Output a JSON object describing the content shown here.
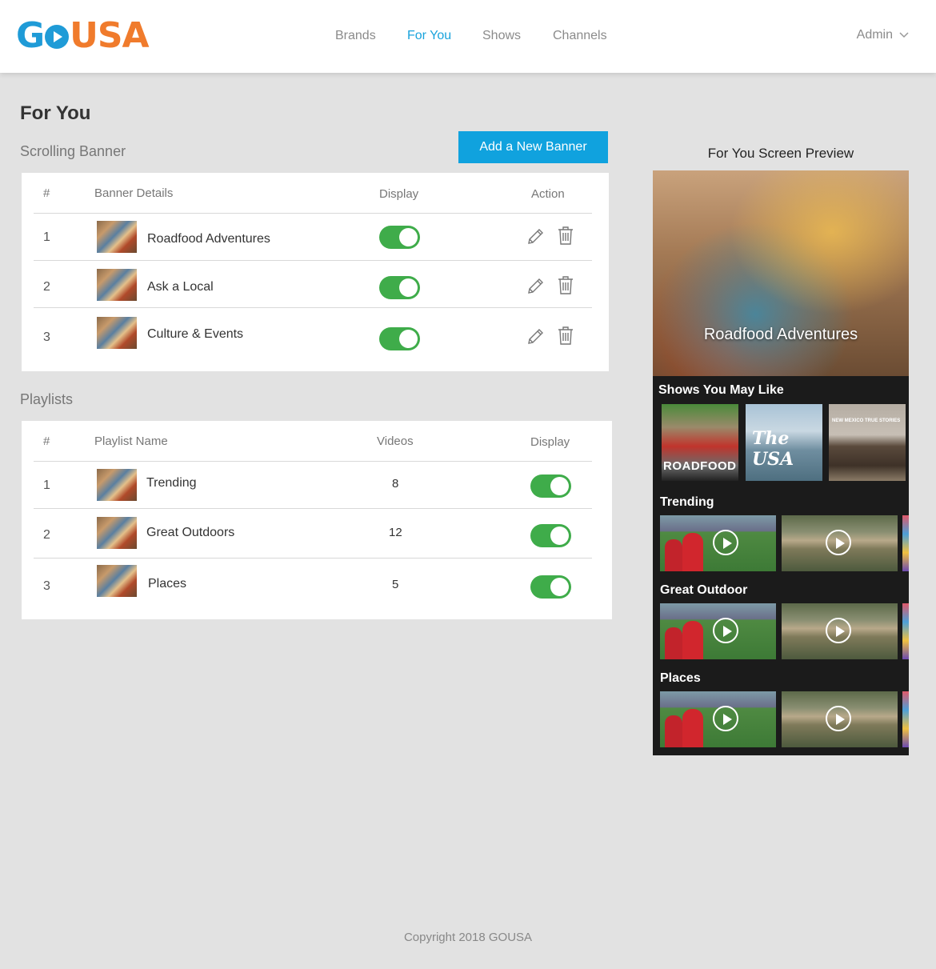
{
  "logo": {
    "part1": "Go",
    "part2": "USA"
  },
  "nav": {
    "items": [
      {
        "label": "Brands",
        "active": false
      },
      {
        "label": "For You",
        "active": true
      },
      {
        "label": "Shows",
        "active": false
      },
      {
        "label": "Channels",
        "active": false
      }
    ],
    "user_label": "Admin"
  },
  "page": {
    "title": "For You"
  },
  "banner_section": {
    "title": "Scrolling Banner",
    "add_button": "Add a New Banner",
    "headers": {
      "num": "#",
      "details": "Banner Details",
      "display": "Display",
      "action": "Action"
    },
    "rows": [
      {
        "num": "1",
        "name": "Roadfood Adventures",
        "display": true
      },
      {
        "num": "2",
        "name": "Ask a Local",
        "display": true
      },
      {
        "num": "3",
        "name": "Culture & Events",
        "display": true
      }
    ]
  },
  "playlist_section": {
    "title": "Playlists",
    "headers": {
      "num": "#",
      "name": "Playlist Name",
      "videos": "Videos",
      "display": "Display"
    },
    "rows": [
      {
        "num": "1",
        "name": "Trending",
        "videos": "8",
        "display": true
      },
      {
        "num": "2",
        "name": "Great Outdoors",
        "videos": "12",
        "display": true
      },
      {
        "num": "3",
        "name": "Places",
        "videos": "5",
        "display": true
      }
    ]
  },
  "preview": {
    "title": "For You Screen Preview",
    "hero_caption": "Roadfood Adventures",
    "shows_title": "Shows You May Like",
    "show_tiles": [
      "ROADFOOD",
      "The USA",
      "NEW MEXICO TRUE STORIES"
    ],
    "rows": [
      "Trending",
      "Great Outdoor",
      "Places"
    ]
  },
  "footer": {
    "copyright": "Copyright 2018 GOUSA"
  },
  "colors": {
    "brand_blue": "#1f9bd7",
    "brand_orange": "#f07b2c",
    "accent": "#10a2de",
    "toggle_on": "#3fac4a"
  }
}
